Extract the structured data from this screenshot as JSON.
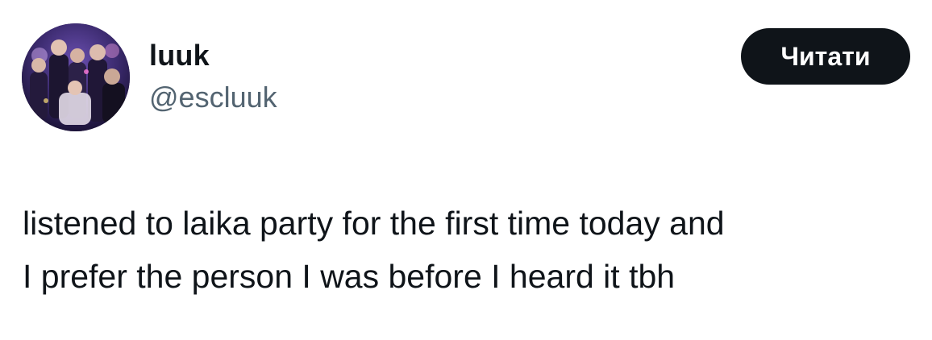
{
  "author": {
    "display_name": "luuk",
    "handle": "@escluuk"
  },
  "actions": {
    "follow_label": "Читати"
  },
  "tweet": {
    "lines": [
      "listened to laika party for the first time today and",
      "I prefer the person I was before I heard it tbh"
    ]
  },
  "colors": {
    "text_primary": "#0f1419",
    "text_secondary": "#536471",
    "button_background": "#0f1419",
    "button_text": "#ffffff",
    "background": "#ffffff"
  }
}
